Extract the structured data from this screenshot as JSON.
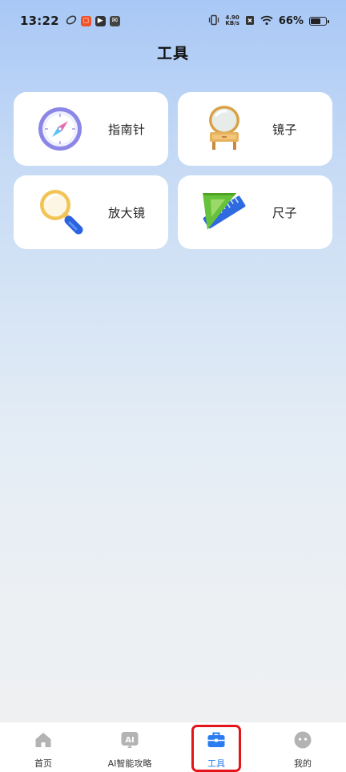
{
  "status_bar": {
    "time": "13:22",
    "net_speed_value": "4.90",
    "net_speed_unit": "KB/s",
    "battery_percent": "66%",
    "battery_level": 0.66
  },
  "page": {
    "title": "工具"
  },
  "tools": [
    {
      "label": "指南针",
      "icon": "compass-icon"
    },
    {
      "label": "镜子",
      "icon": "mirror-icon"
    },
    {
      "label": "放大镜",
      "icon": "magnifier-icon"
    },
    {
      "label": "尺子",
      "icon": "ruler-icon"
    }
  ],
  "bottom_nav": {
    "items": [
      {
        "label": "首页",
        "icon": "home-icon",
        "active": false
      },
      {
        "label": "AI智能攻略",
        "icon": "ai-icon",
        "active": false
      },
      {
        "label": "工具",
        "icon": "toolbox-icon",
        "active": true
      },
      {
        "label": "我的",
        "icon": "profile-icon",
        "active": false
      }
    ]
  },
  "colors": {
    "accent": "#2a7cf0",
    "highlight": "#e3151a"
  }
}
